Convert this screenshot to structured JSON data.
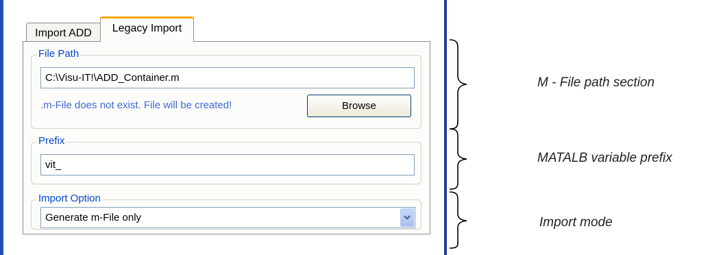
{
  "tabs": [
    {
      "label": "Import ADD",
      "active": false
    },
    {
      "label": "Legacy Import",
      "active": true
    }
  ],
  "file_path": {
    "legend": "File Path",
    "value": "C:\\Visu-IT!\\ADD_Container.m",
    "status": ".m-File does not exist. File will be created!",
    "browse_label": "Browse"
  },
  "prefix": {
    "legend": "Prefix",
    "value": "vit_"
  },
  "import_option": {
    "legend": "Import Option",
    "selected": "Generate m-File only",
    "arrow_icon": "chevron-down-icon"
  },
  "annotations": {
    "file_path_section": "M - File path section",
    "prefix_section": "MATALB variable prefix",
    "import_mode": "Import mode"
  },
  "colors": {
    "legend_text": "#0046d5",
    "status_text": "#3f6ad9",
    "active_tab_accent": "#ffa500",
    "window_border": "#1f3f9c"
  }
}
